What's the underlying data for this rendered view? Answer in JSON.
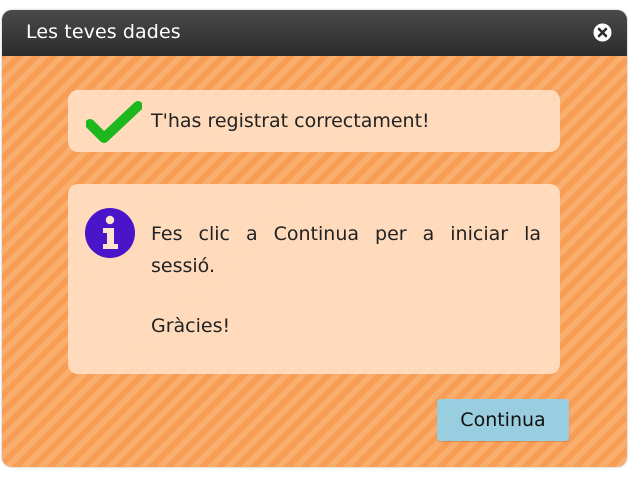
{
  "dialog": {
    "title": "Les teves dades",
    "close_icon": "close-circle-icon"
  },
  "success": {
    "icon": "checkmark-icon",
    "message": "T'has registrat correctament!"
  },
  "info": {
    "icon": "info-icon",
    "paragraph1": "Fes clic a Continua per a iniciar la sessió.",
    "paragraph2": "Gràcies!"
  },
  "actions": {
    "continue_label": "Continua"
  },
  "colors": {
    "accent_orange": "#f8a25c",
    "check_green": "#1db81d",
    "info_purple": "#4a14c8",
    "button_blue": "#99cde0"
  }
}
